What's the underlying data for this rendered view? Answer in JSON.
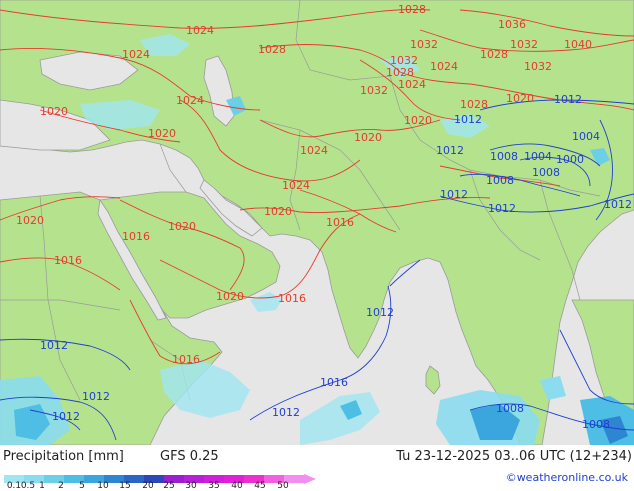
{
  "footer": {
    "title": "Precipitation [mm]",
    "model": "GFS 0.25",
    "valid_time": "Tu 23-12-2025 03..06 UTC (12+234)",
    "credit": "©weatheronline.co.uk"
  },
  "legend": {
    "ticks": [
      "0.1",
      "0.5",
      "1",
      "2",
      "5",
      "10",
      "15",
      "20",
      "25",
      "30",
      "35",
      "40",
      "45",
      "50"
    ],
    "colors": [
      "#a0e6f2",
      "#8adcee",
      "#6ccfe8",
      "#4ebee4",
      "#3aa6dd",
      "#2e86d2",
      "#2a66c5",
      "#2a48b8",
      "#9a1fd0",
      "#b81fd8",
      "#cf1fdb",
      "#e01fd7",
      "#ec2fcf",
      "#f25fdf",
      "#f08ff0"
    ]
  },
  "colors": {
    "land": "#b5e38d",
    "sea": "#e6e6e6",
    "isobar_high": "#e53b2c",
    "isobar_low": "#1f3fd1",
    "border": "#9a9a9a"
  },
  "isobar_labels": [
    {
      "text": "1028",
      "style": "red"
    },
    {
      "text": "1024",
      "style": "red"
    },
    {
      "text": "1028",
      "style": "red"
    },
    {
      "text": "1036",
      "style": "red"
    },
    {
      "text": "1032",
      "style": "red"
    },
    {
      "text": "1028",
      "style": "red"
    },
    {
      "text": "1032",
      "style": "red"
    },
    {
      "text": "1040",
      "style": "red"
    },
    {
      "text": "1024",
      "style": "red"
    },
    {
      "text": "1032",
      "style": "red"
    },
    {
      "text": "1024",
      "style": "red"
    },
    {
      "text": "1032",
      "style": "red"
    },
    {
      "text": "1028",
      "style": "red"
    },
    {
      "text": "1024",
      "style": "red"
    },
    {
      "text": "1032",
      "style": "red"
    },
    {
      "text": "1020",
      "style": "red"
    },
    {
      "text": "1024",
      "style": "red"
    },
    {
      "text": "1028",
      "style": "red"
    },
    {
      "text": "1020",
      "style": "red"
    },
    {
      "text": "1012",
      "style": "blue"
    },
    {
      "text": "1020",
      "style": "red"
    },
    {
      "text": "1020",
      "style": "red"
    },
    {
      "text": "1020",
      "style": "red"
    },
    {
      "text": "1012",
      "style": "blue"
    },
    {
      "text": "1004",
      "style": "blue"
    },
    {
      "text": "1024",
      "style": "red"
    },
    {
      "text": "1012",
      "style": "blue"
    },
    {
      "text": "1008",
      "style": "blue"
    },
    {
      "text": "1004",
      "style": "blue"
    },
    {
      "text": "1000",
      "style": "blue"
    },
    {
      "text": "1008",
      "style": "blue"
    },
    {
      "text": "1008",
      "style": "blue"
    },
    {
      "text": "1024",
      "style": "red"
    },
    {
      "text": "1012",
      "style": "blue"
    },
    {
      "text": "1012",
      "style": "blue"
    },
    {
      "text": "1020",
      "style": "red"
    },
    {
      "text": "1016",
      "style": "red"
    },
    {
      "text": "1020",
      "style": "red"
    },
    {
      "text": "1016",
      "style": "red"
    },
    {
      "text": "1012",
      "style": "blue"
    },
    {
      "text": "1020",
      "style": "red"
    },
    {
      "text": "1016",
      "style": "red"
    },
    {
      "text": "1016",
      "style": "red"
    },
    {
      "text": "1020",
      "style": "red"
    },
    {
      "text": "1016",
      "style": "red"
    },
    {
      "text": "1012",
      "style": "blue"
    },
    {
      "text": "1012",
      "style": "blue"
    },
    {
      "text": "1016",
      "style": "red"
    },
    {
      "text": "1012",
      "style": "blue"
    },
    {
      "text": "1012",
      "style": "blue"
    },
    {
      "text": "1012",
      "style": "blue"
    },
    {
      "text": "1008",
      "style": "blue"
    },
    {
      "text": "1008",
      "style": "blue"
    }
  ]
}
